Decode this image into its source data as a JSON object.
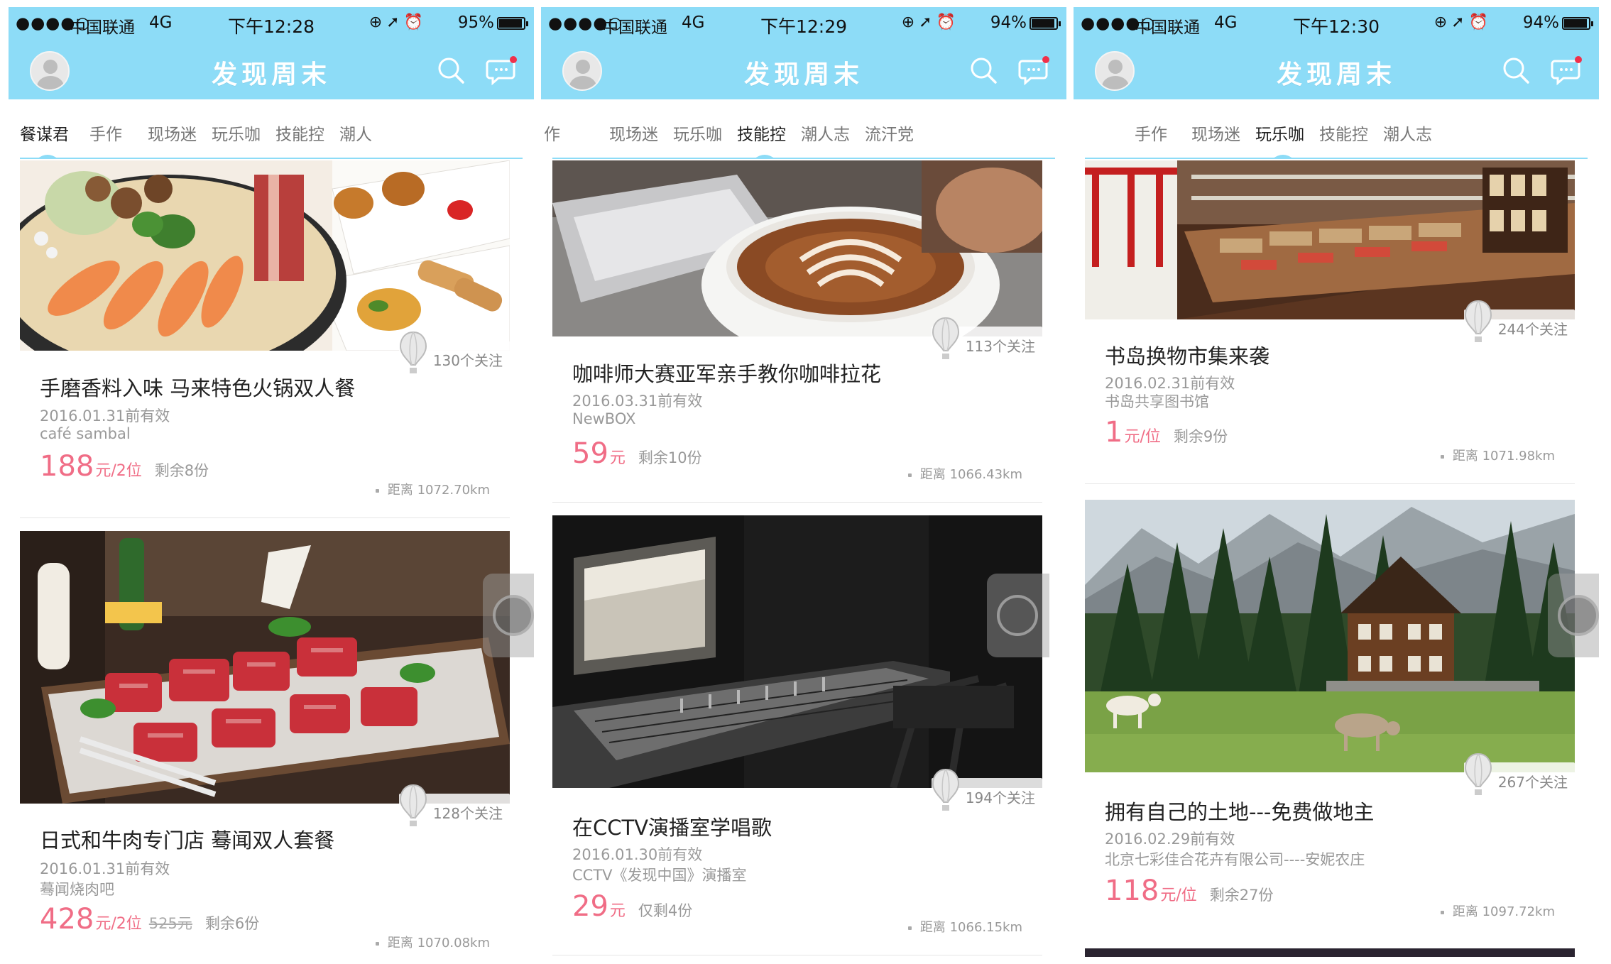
{
  "status": {
    "signal": "●●●●○",
    "carrier": "中国联通",
    "network": "4G"
  },
  "app": {
    "title": "发现周末",
    "accent": "#8ddcf7",
    "price_color": "#f06d86"
  },
  "icons": [
    "avatar-icon",
    "search-icon",
    "message-icon",
    "balloon-icon",
    "lock-icon",
    "location-arrow-icon",
    "alarm-icon",
    "battery-icon"
  ],
  "screens": [
    {
      "time": "下午12:28",
      "battery": "95%",
      "battery_level": 0.95,
      "tabs": [
        "餐谋君",
        "手作",
        "现场迷",
        "玩乐咖",
        "技能控",
        "潮人"
      ],
      "active_tab": 0,
      "cards": [
        {
          "follow": "130个关注",
          "title": "手磨香料入味 马来特色火锅双人餐",
          "valid": "2016.01.31前有效",
          "venue": "café sambal",
          "price": "188",
          "unit": "元/2位",
          "original": "",
          "remaining": "剩余8份",
          "distance": "距离 1072.70km"
        },
        {
          "follow": "128个关注",
          "title": "日式和牛肉专门店 蓦闻双人套餐",
          "valid": "2016.01.31前有效",
          "venue": "蓦闻烧肉吧",
          "price": "428",
          "unit": "元/2位",
          "original": "525元",
          "remaining": "剩余6份",
          "distance": "距离 1070.08km"
        }
      ]
    },
    {
      "time": "下午12:29",
      "battery": "94%",
      "battery_level": 0.94,
      "tabs": [
        "作",
        "现场迷",
        "玩乐咖",
        "技能控",
        "潮人志",
        "流汗党"
      ],
      "active_tab": 3,
      "cards": [
        {
          "follow": "113个关注",
          "title": "咖啡师大赛亚军亲手教你咖啡拉花",
          "valid": "2016.03.31前有效",
          "venue": "NewBOX",
          "price": "59",
          "unit": "元",
          "original": "",
          "remaining": "剩余10份",
          "distance": "距离 1066.43km"
        },
        {
          "follow": "194个关注",
          "title": "在CCTV演播室学唱歌",
          "valid": "2016.01.30前有效",
          "venue": "CCTV《发现中国》演播室",
          "price": "29",
          "unit": "元",
          "original": "",
          "remaining": "仅剩4份",
          "distance": "距离 1066.15km"
        }
      ]
    },
    {
      "time": "下午12:30",
      "battery": "94%",
      "battery_level": 0.94,
      "tabs": [
        "手作",
        "现场迷",
        "玩乐咖",
        "技能控",
        "潮人志"
      ],
      "active_tab": 2,
      "cards": [
        {
          "follow": "244个关注",
          "title": "书岛换物市集来袭",
          "valid": "2016.02.31前有效",
          "venue": "书岛共享图书馆",
          "price": "1",
          "unit": "元/位",
          "original": "",
          "remaining": "剩余9份",
          "distance": "距离 1071.98km"
        },
        {
          "follow": "267个关注",
          "title": "拥有自己的土地---免费做地主",
          "valid": "2016.02.29前有效",
          "venue": "北京七彩佳合花卉有限公司----安妮农庄",
          "price": "118",
          "unit": "元/位",
          "original": "",
          "remaining": "剩余27份",
          "distance": "距离 1097.72km"
        }
      ]
    }
  ]
}
